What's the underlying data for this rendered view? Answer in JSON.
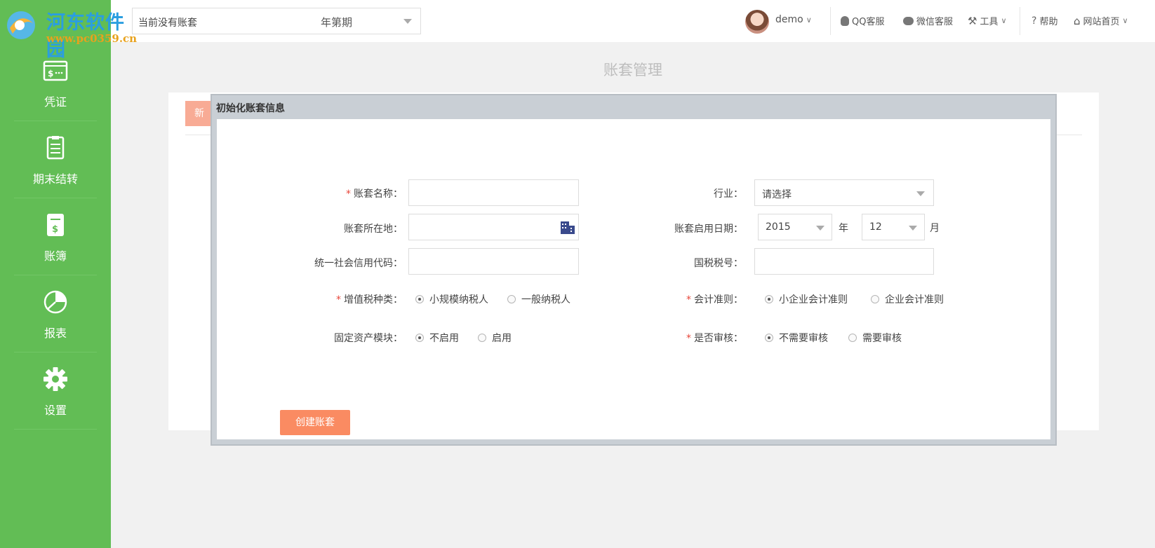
{
  "brand": {
    "watermark_title": "河东软件园",
    "watermark_url": "www.pc0359.cn"
  },
  "colors": {
    "sidebar": "#62bd55",
    "primary_button": "#fa8b62",
    "required": "#e8463a"
  },
  "sidebar": {
    "items": [
      {
        "label": "凭证",
        "icon": "voucher-icon"
      },
      {
        "label": "期末结转",
        "icon": "clipboard-checklist-icon"
      },
      {
        "label": "账簿",
        "icon": "ledger-book-icon"
      },
      {
        "label": "报表",
        "icon": "pie-chart-icon"
      },
      {
        "label": "设置",
        "icon": "gear-icon"
      }
    ]
  },
  "topbar": {
    "account_select": "当前没有账套",
    "period_label": "年第期",
    "user": "demo",
    "qq_service": "QQ客服",
    "wechat_service": "微信客服",
    "tools": "工具",
    "help": "帮助",
    "site_home": "网站首页"
  },
  "page": {
    "title": "账套管理",
    "new_button": "新"
  },
  "modal": {
    "title": "初始化账套信息",
    "fields": {
      "account_name": {
        "label": "账套名称：",
        "value": ""
      },
      "location": {
        "label": "账套所在地：",
        "value": ""
      },
      "credit_code": {
        "label": "统一社会信用代码：",
        "value": ""
      },
      "vat_type": {
        "label": "增值税种类：",
        "options": [
          "小规模纳税人",
          "一般纳税人"
        ],
        "selected": "小规模纳税人"
      },
      "fixed_assets": {
        "label": "固定资产模块：",
        "options": [
          "不启用",
          "启用"
        ],
        "selected": "不启用"
      },
      "industry": {
        "label": "行业：",
        "value": "请选择"
      },
      "start_date": {
        "label": "账套启用日期：",
        "year": "2015",
        "year_unit": "年",
        "month": "12",
        "month_unit": "月"
      },
      "tax_number": {
        "label": "国税税号：",
        "value": ""
      },
      "accounting_standard": {
        "label": "会计准则：",
        "options": [
          "小企业会计准则",
          "企业会计准则"
        ],
        "selected": "小企业会计准则"
      },
      "audit": {
        "label": "是否审核：",
        "options": [
          "不需要审核",
          "需要审核"
        ],
        "selected": "不需要审核"
      }
    },
    "create_button": "创建账套"
  }
}
